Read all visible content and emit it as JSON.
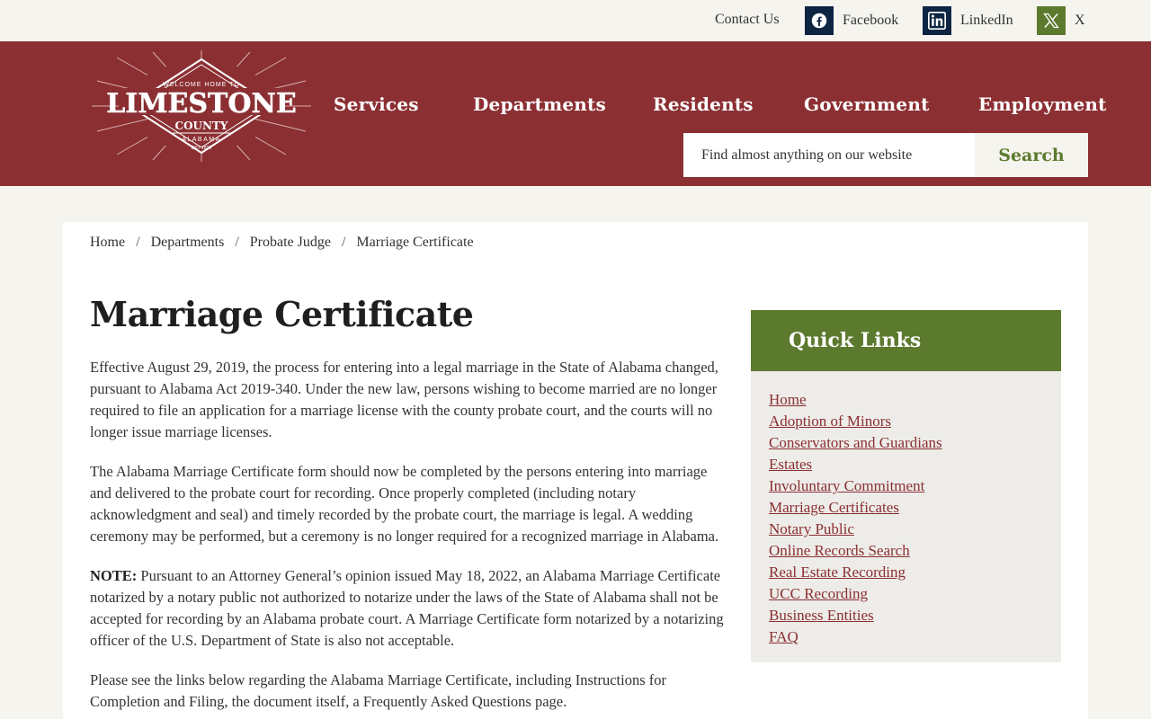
{
  "topbar": {
    "contact": "Contact Us",
    "facebook": "Facebook",
    "linkedin": "LinkedIn",
    "x": "X"
  },
  "logo": {
    "tagline": "WELCOME HOME TO",
    "name": "LIMESTONE",
    "county": "COUNTY",
    "state": "ALABAMA",
    "est": "EST 1818"
  },
  "nav": {
    "items": [
      "Services",
      "Departments",
      "Residents",
      "Government",
      "Employment"
    ]
  },
  "search": {
    "placeholder": "Find almost anything on our website",
    "button": "Search"
  },
  "breadcrumb": [
    "Home",
    "Departments",
    "Probate Judge",
    "Marriage Certificate"
  ],
  "page": {
    "title": "Marriage Certificate",
    "p1": "Effective August 29, 2019, the process for entering into a legal marriage in the State of Alabama changed, pursuant to Alabama Act 2019-340. Under the new law, persons wishing to become married are no longer required to file an application for a marriage license with the county probate court, and the courts will no longer issue marriage licenses.",
    "p2": "The Alabama Marriage Certificate form should now be completed by the persons entering into marriage and delivered to the probate court for recording. Once properly completed (including notary acknowledgment and seal) and timely recorded by the probate court, the marriage is legal. A wedding ceremony may be performed, but a ceremony is no longer required for a recognized marriage in Alabama.",
    "note_label": "NOTE:",
    "note_text": " Pursuant to an Attorney General’s opinion issued May 18, 2022, an Alabama Marriage Certificate notarized by a notary public not authorized to notarize under the laws of the State of Alabama shall not be accepted for recording by an Alabama probate court. A Marriage Certificate form notarized by a notarizing officer of the U.S. Department of State is also not acceptable.",
    "p4": "Please see the links below regarding the Alabama Marriage Certificate, including Instructions for Completion and Filing, the document itself, a Frequently Asked Questions page."
  },
  "quick_links": {
    "title": "Quick Links",
    "items": [
      "Home",
      "Adoption of Minors",
      "Conservators and Guardians",
      "Estates",
      "Involuntary Commitment",
      "Marriage Certificates",
      "Notary Public",
      "Online Records Search",
      "Real Estate Recording",
      "UCC Recording",
      "Business Entities",
      "FAQ"
    ]
  },
  "colors": {
    "brand_red": "#8b2f33",
    "brand_green": "#5c7a2e",
    "navy": "#0d2542",
    "cream": "#f5f4ee"
  }
}
